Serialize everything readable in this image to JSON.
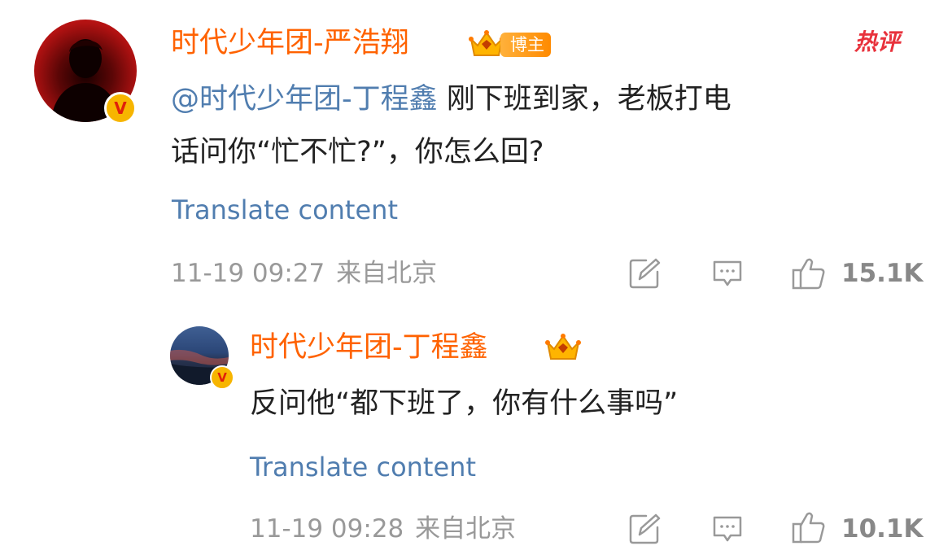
{
  "hot_badge": "热评",
  "comment": {
    "username": "时代少年团-严浩翔",
    "blogger_tag": "博主",
    "mention": "@时代少年团-丁程鑫",
    "text_line1": " 刚下班到家，老板打电",
    "text_line2": "话问你“忙不忙?”，你怎么回?",
    "translate_label": "Translate content",
    "date": "11-19 09:27",
    "location": "来自北京",
    "like_count": "15.1K"
  },
  "reply": {
    "username": "时代少年团-丁程鑫",
    "text": "反问他“都下班了，你有什么事吗”",
    "translate_label": "Translate content",
    "date": "11-19 09:28",
    "location": "来自北京",
    "like_count": "10.1K"
  },
  "colors": {
    "username": "#ff6200",
    "link": "#507daf",
    "meta": "#999999",
    "hot": "#e8323c"
  }
}
